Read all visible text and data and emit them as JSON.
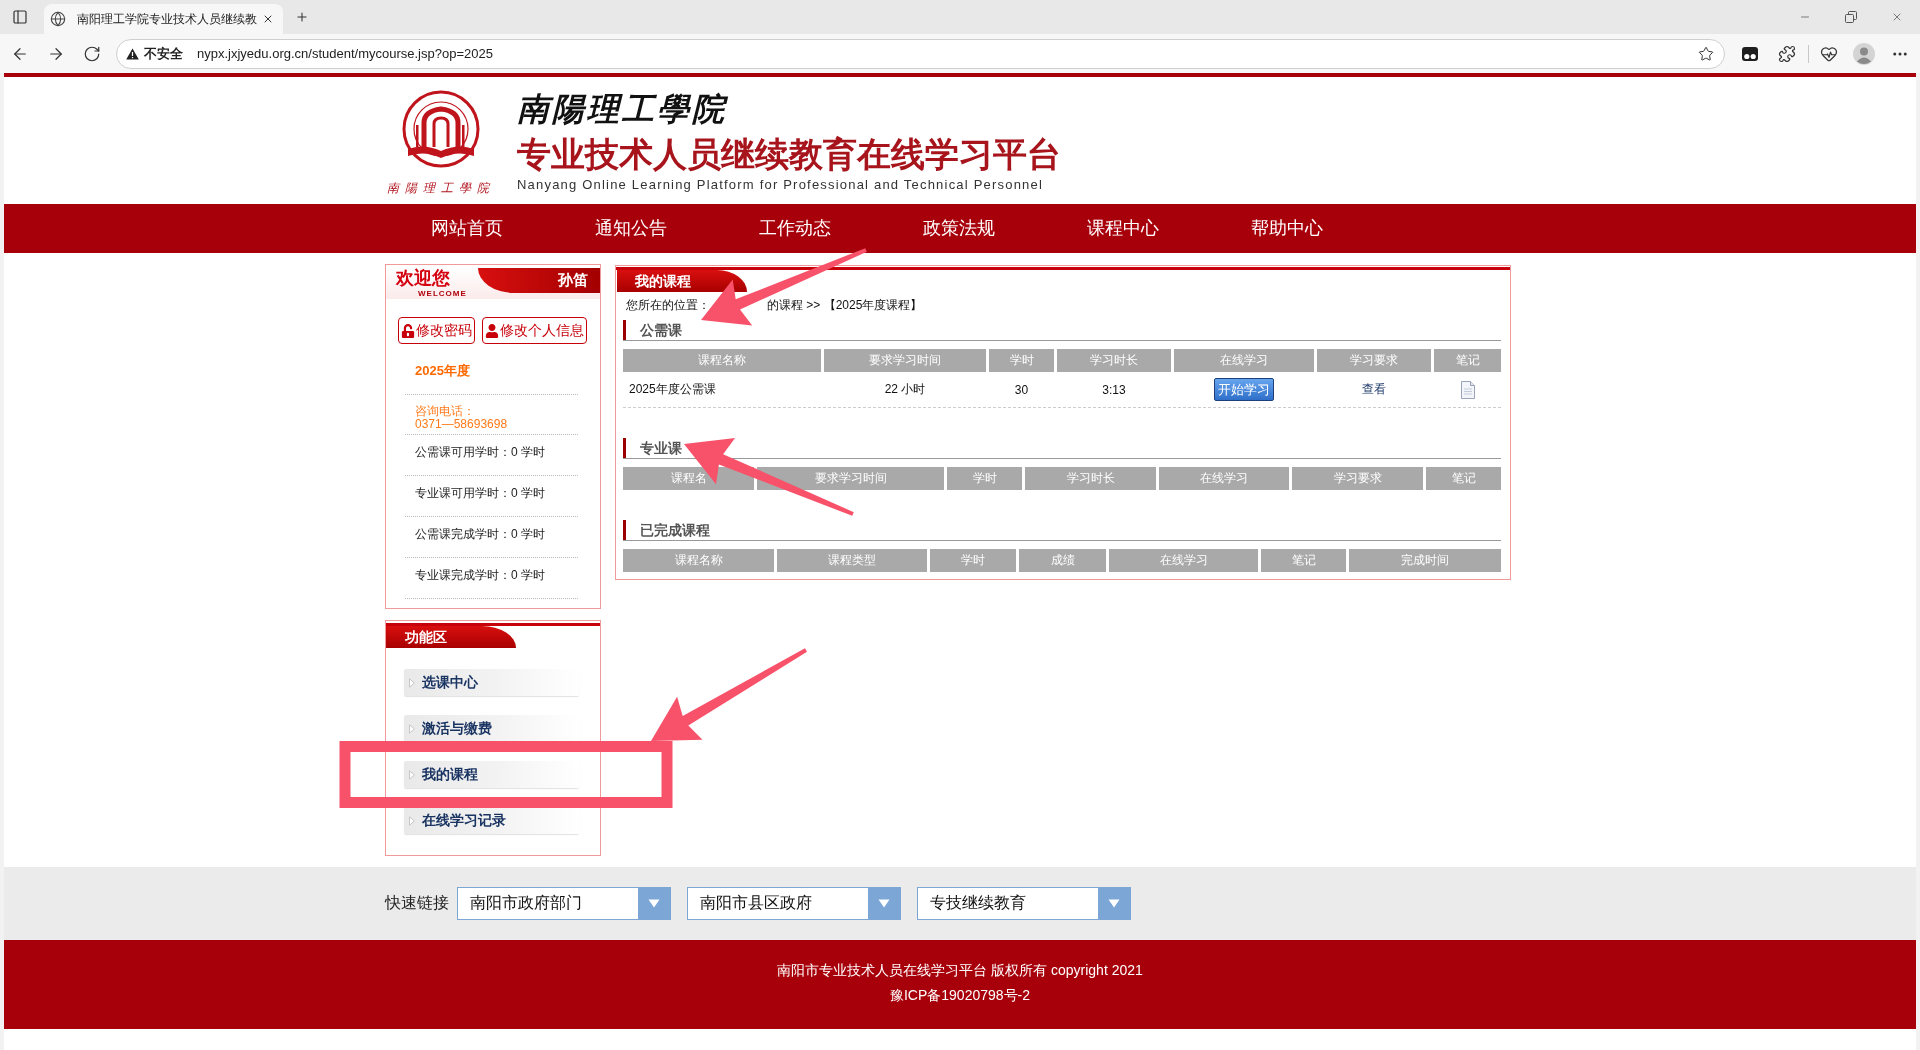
{
  "browser": {
    "tab_title": "南阳理工学院专业技术人员继续教",
    "security_label": "不安全",
    "url": "nypx.jxjyedu.org.cn/student/mycourse.jsp?op=2025"
  },
  "header": {
    "logo_caption": "南陽理工學院",
    "calligraphy_title": "南陽理工學院",
    "title": "专业技术人员继续教育在线学习平台",
    "subtitle": "Nanyang Online Learning Platform for Professional and Technical Personnel"
  },
  "nav": [
    "网站首页",
    "通知公告",
    "工作动态",
    "政策法规",
    "课程中心",
    "帮助中心"
  ],
  "welcome_panel": {
    "greeting": "欢迎您",
    "greeting_sub": "WELCOME",
    "user_name": "孙笛",
    "buttons": [
      {
        "kind": "lock",
        "label": "修改密码"
      },
      {
        "kind": "user",
        "label": "修改个人信息"
      }
    ],
    "year": "2025年度",
    "hotline_label": "咨询电话：",
    "hotline": "0371—58693698",
    "stats": [
      "公需课可用学时：0 学时",
      "专业课可用学时：0 学时",
      "公需课完成学时：0 学时",
      "专业课完成学时：0 学时"
    ]
  },
  "function_panel": {
    "title": "功能区",
    "items": [
      "选课中心",
      "激活与缴费",
      "我的课程",
      "在线学习记录"
    ]
  },
  "main_panel": {
    "title": "我的课程",
    "breadcrumb": {
      "label": "您所在的位置：",
      "trail": "的课程 >> 【2025年度课程】"
    },
    "sections": [
      {
        "title": "公需课",
        "columns": [
          "课程名称",
          "要求学习时间",
          "学时",
          "学习时长",
          "在线学习",
          "学习要求",
          "笔记"
        ],
        "rows": [
          {
            "cells": [
              {
                "kind": "title",
                "text": "2025年度公需课"
              },
              {
                "kind": "text",
                "text": "22 小时"
              },
              {
                "kind": "text",
                "text": "30"
              },
              {
                "kind": "text",
                "text": "3:13"
              },
              {
                "kind": "button",
                "text": "开始学习"
              },
              {
                "kind": "link",
                "text": "查看"
              },
              {
                "kind": "note"
              }
            ]
          }
        ]
      },
      {
        "title": "专业课",
        "columns": [
          "课程名",
          "要求学习时间",
          "学时",
          "学习时长",
          "在线学习",
          "学习要求",
          "笔记"
        ]
      },
      {
        "title": "已完成课程",
        "columns": [
          "课程名称",
          "课程类型",
          "学时",
          "成绩",
          "在线学习",
          "笔记",
          "完成时间"
        ]
      }
    ]
  },
  "quick_links": {
    "label": "快速链接",
    "selects": [
      "南阳市政府部门",
      "南阳市县区政府",
      "专技继续教育"
    ]
  },
  "footer": {
    "lines": [
      "南阳市专业技术人员在线学习平台 版权所有 copyright 2021",
      "豫ICP备19020798号-2"
    ]
  },
  "annotations": [
    {
      "kind": "arrow"
    },
    {
      "kind": "arrow"
    },
    {
      "kind": "arrow"
    },
    {
      "kind": "frame"
    }
  ]
}
